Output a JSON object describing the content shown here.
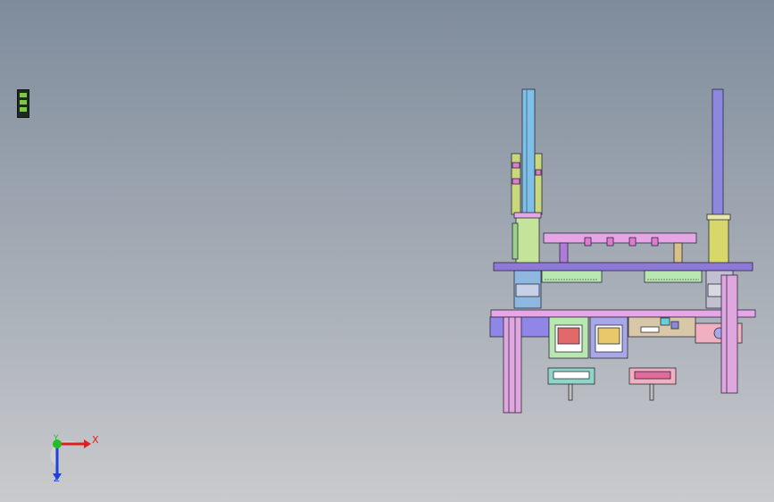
{
  "viewport": {
    "background_top": "#7f8c9c",
    "background_bottom": "#c9cacd"
  },
  "triad": {
    "x_label": "X",
    "y_label": "Y",
    "z_label": "Z",
    "x_color": "#e02020",
    "y_color": "#20c020",
    "z_color": "#2040e0"
  },
  "model": {
    "colors": {
      "column_left": "#7ec0e8",
      "column_right": "#8c88e0",
      "plate": "#8f79d8",
      "rail": "#d69ad6",
      "base": "#e7a6e7",
      "sleeve": "#d8d86a",
      "panel_green": "#b8e8b0",
      "panel_purple": "#a8a8e8",
      "clamp_teal": "#8fd6c8",
      "clamp_red": "#e06a9a"
    }
  }
}
